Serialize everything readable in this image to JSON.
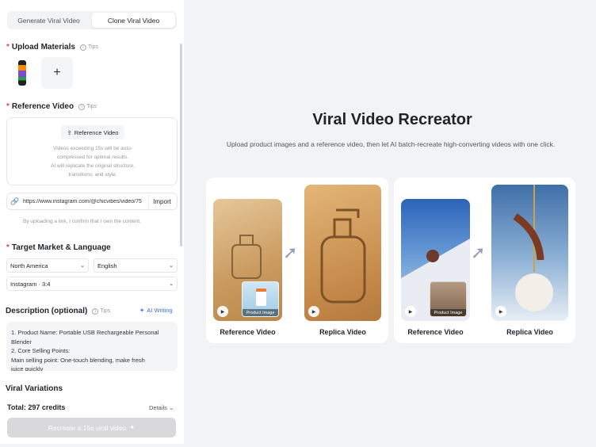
{
  "tabs": {
    "generate": "Generate Viral Video",
    "clone": "Clone Viral Video"
  },
  "upload": {
    "label": "Upload Materials",
    "tips": "Tips",
    "add": "+"
  },
  "reference": {
    "label": "Reference Video",
    "tips": "Tips",
    "button": "Reference Video",
    "note_1": "Videos exceeding 15s will be auto-",
    "note_2": "compressed for optimal results.",
    "note_3": "AI will replicate the original structure,",
    "note_4": "transitions, and style."
  },
  "link": {
    "url": "https://www.instagram.com/@chicvibes/video/75",
    "import": "Import",
    "confirm": "By uploading a link, I confirm that I own the content."
  },
  "target": {
    "label": "Target Market & Language",
    "market": "North America",
    "language": "English",
    "platform": "Instagram · 3:4"
  },
  "description": {
    "label": "Description (optional)",
    "tips": "Tips",
    "ai_writing": "AI Writing",
    "line1": "1. Product Name: Portable USB Rechargeable Personal",
    "line2": "Blender",
    "line3": "2. Core Selling Points:",
    "line4": "Main selling point: One-touch blending, make fresh",
    "line5": "juice quickly"
  },
  "variations": {
    "label": "Viral Variations"
  },
  "footer": {
    "total": "Total: 297 credits",
    "details": "Details",
    "recreate": "Recreate a 15s viral video"
  },
  "hero": {
    "title": "Viral Video Recreator",
    "subtitle": "Upload product images and a reference video, then let AI batch-recreate high-converting videos with one click."
  },
  "examples": [
    {
      "ref_label": "Reference Video",
      "replica_label": "Replica Video",
      "product_label": "Product Image"
    },
    {
      "ref_label": "Reference Video",
      "replica_label": "Replica Video",
      "product_label": "Product Image"
    }
  ],
  "icons": {
    "play": "play-icon",
    "upload": "upload-icon",
    "link": "link-icon",
    "sparkle": "sparkle-icon"
  },
  "colors": {
    "accent": "#3b6fe0",
    "required": "#e5484d",
    "button_disabled": "#d9d9dc"
  }
}
